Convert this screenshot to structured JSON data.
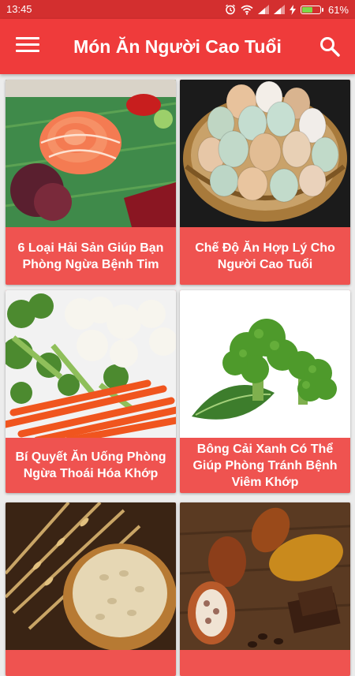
{
  "status_bar": {
    "time": "13:45",
    "battery": "61%",
    "battery_level": 0.61
  },
  "app_bar": {
    "title": "Món Ăn Người Cao Tuổi"
  },
  "cards": [
    {
      "title": "6 Loại Hải Sản Giúp Bạn Phòng Ngừa Bệnh Tim"
    },
    {
      "title": "Chế Độ Ăn Hợp Lý Cho Người Cao Tuổi"
    },
    {
      "title": "Bí Quyết Ăn Uống Phòng Ngừa Thoái Hóa Khớp"
    },
    {
      "title": "Bông Cải Xanh Có Thể Giúp Phòng Tránh Bệnh Viêm Khớp"
    },
    {
      "title": ""
    },
    {
      "title": ""
    }
  ],
  "colors": {
    "status_bar": "#d32f2f",
    "app_bar": "#ef3b3b",
    "card": "#ef5350",
    "background": "#ececec"
  }
}
